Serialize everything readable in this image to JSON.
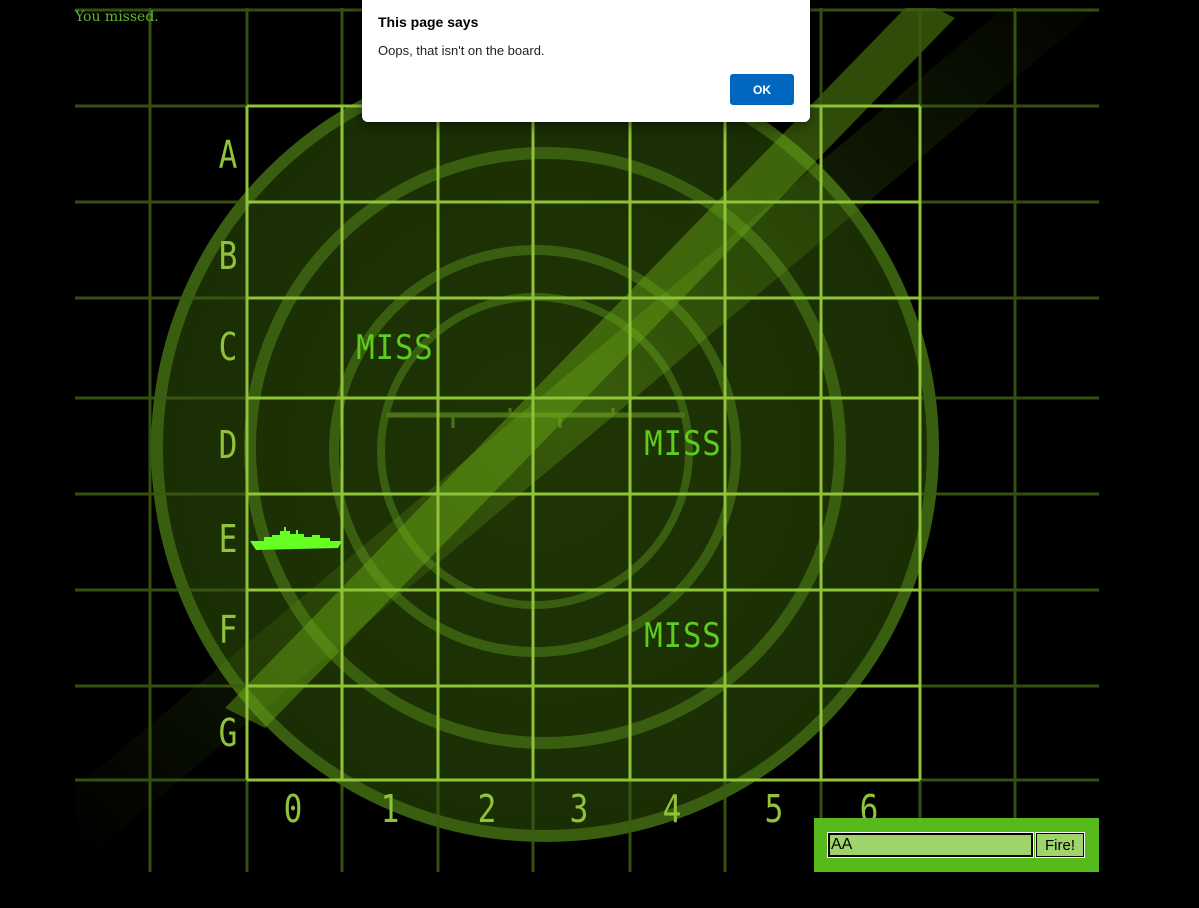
{
  "message": "You missed.",
  "board": {
    "rows": [
      "A",
      "B",
      "C",
      "D",
      "E",
      "F",
      "G"
    ],
    "columns": [
      "0",
      "1",
      "2",
      "3",
      "4",
      "5",
      "6"
    ],
    "misses": [
      {
        "row": "C",
        "col": "1",
        "label": "MISS"
      },
      {
        "row": "D",
        "col": "4",
        "label": "MISS"
      },
      {
        "row": "F",
        "col": "4",
        "label": "MISS"
      }
    ],
    "hits": [
      {
        "row": "E",
        "col": "0",
        "marker": "ship-icon"
      }
    ],
    "colors": {
      "grid": "#8fc33a",
      "radar": "#2e4a0c",
      "miss": "#5fcb1e",
      "ship": "#66ff22"
    }
  },
  "form": {
    "guess_value": "AA",
    "fire_label": "Fire!"
  },
  "alert": {
    "title": "This page says",
    "message": "Oops, that isn't on the board.",
    "ok_label": "OK"
  }
}
